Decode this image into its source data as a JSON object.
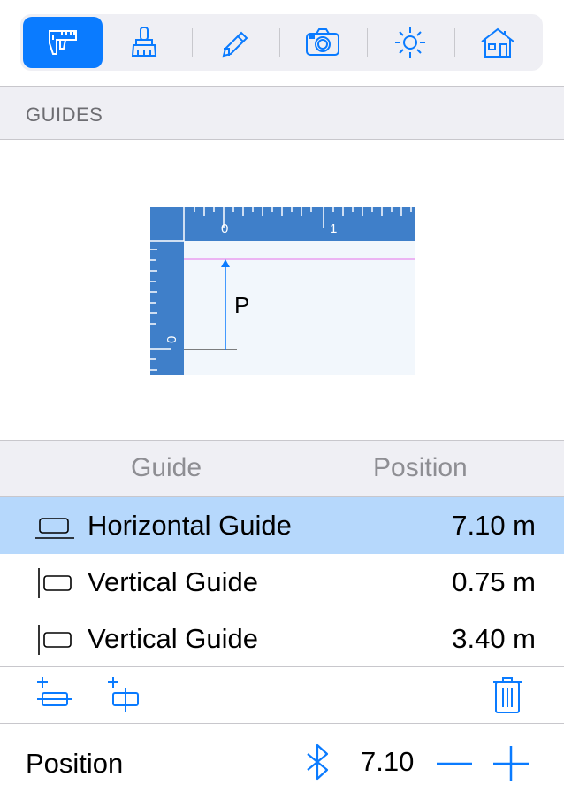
{
  "toolbar": {
    "tools": [
      {
        "name": "measure-tool",
        "icon": "caliper-icon",
        "active": true
      },
      {
        "name": "brush-tool",
        "icon": "brush-icon",
        "active": false
      },
      {
        "name": "pencil-tool",
        "icon": "pencil-icon",
        "active": false
      },
      {
        "name": "camera-tool",
        "icon": "camera-icon",
        "active": false
      },
      {
        "name": "light-tool",
        "icon": "sun-icon",
        "active": false
      },
      {
        "name": "house-tool",
        "icon": "house-icon",
        "active": false
      }
    ]
  },
  "section": {
    "title": "GUIDES"
  },
  "diagram": {
    "ruler_top_labels": [
      "0",
      "1"
    ],
    "ruler_left_label": "0",
    "arrow_label": "P"
  },
  "table": {
    "columns": [
      "Guide",
      "Position"
    ],
    "rows": [
      {
        "icon": "horizontal-guide-icon",
        "name": "Horizontal Guide",
        "value": "7.10 m",
        "selected": true
      },
      {
        "icon": "vertical-guide-icon",
        "name": "Vertical Guide",
        "value": "0.75 m",
        "selected": false
      },
      {
        "icon": "vertical-guide-icon",
        "name": "Vertical Guide",
        "value": "3.40 m",
        "selected": false
      }
    ]
  },
  "actions": {
    "add_horizontal": "add-horizontal-guide-icon",
    "add_vertical": "add-vertical-guide-icon",
    "delete": "trash-icon"
  },
  "position_bar": {
    "label": "Position",
    "value": "7.10",
    "bluetooth_icon": "bluetooth-icon"
  },
  "colors": {
    "accent": "#0a7bff",
    "selected_row": "#b6d8fc",
    "ruler": "#3f7fc9",
    "guide_line": "#e99ef0"
  }
}
